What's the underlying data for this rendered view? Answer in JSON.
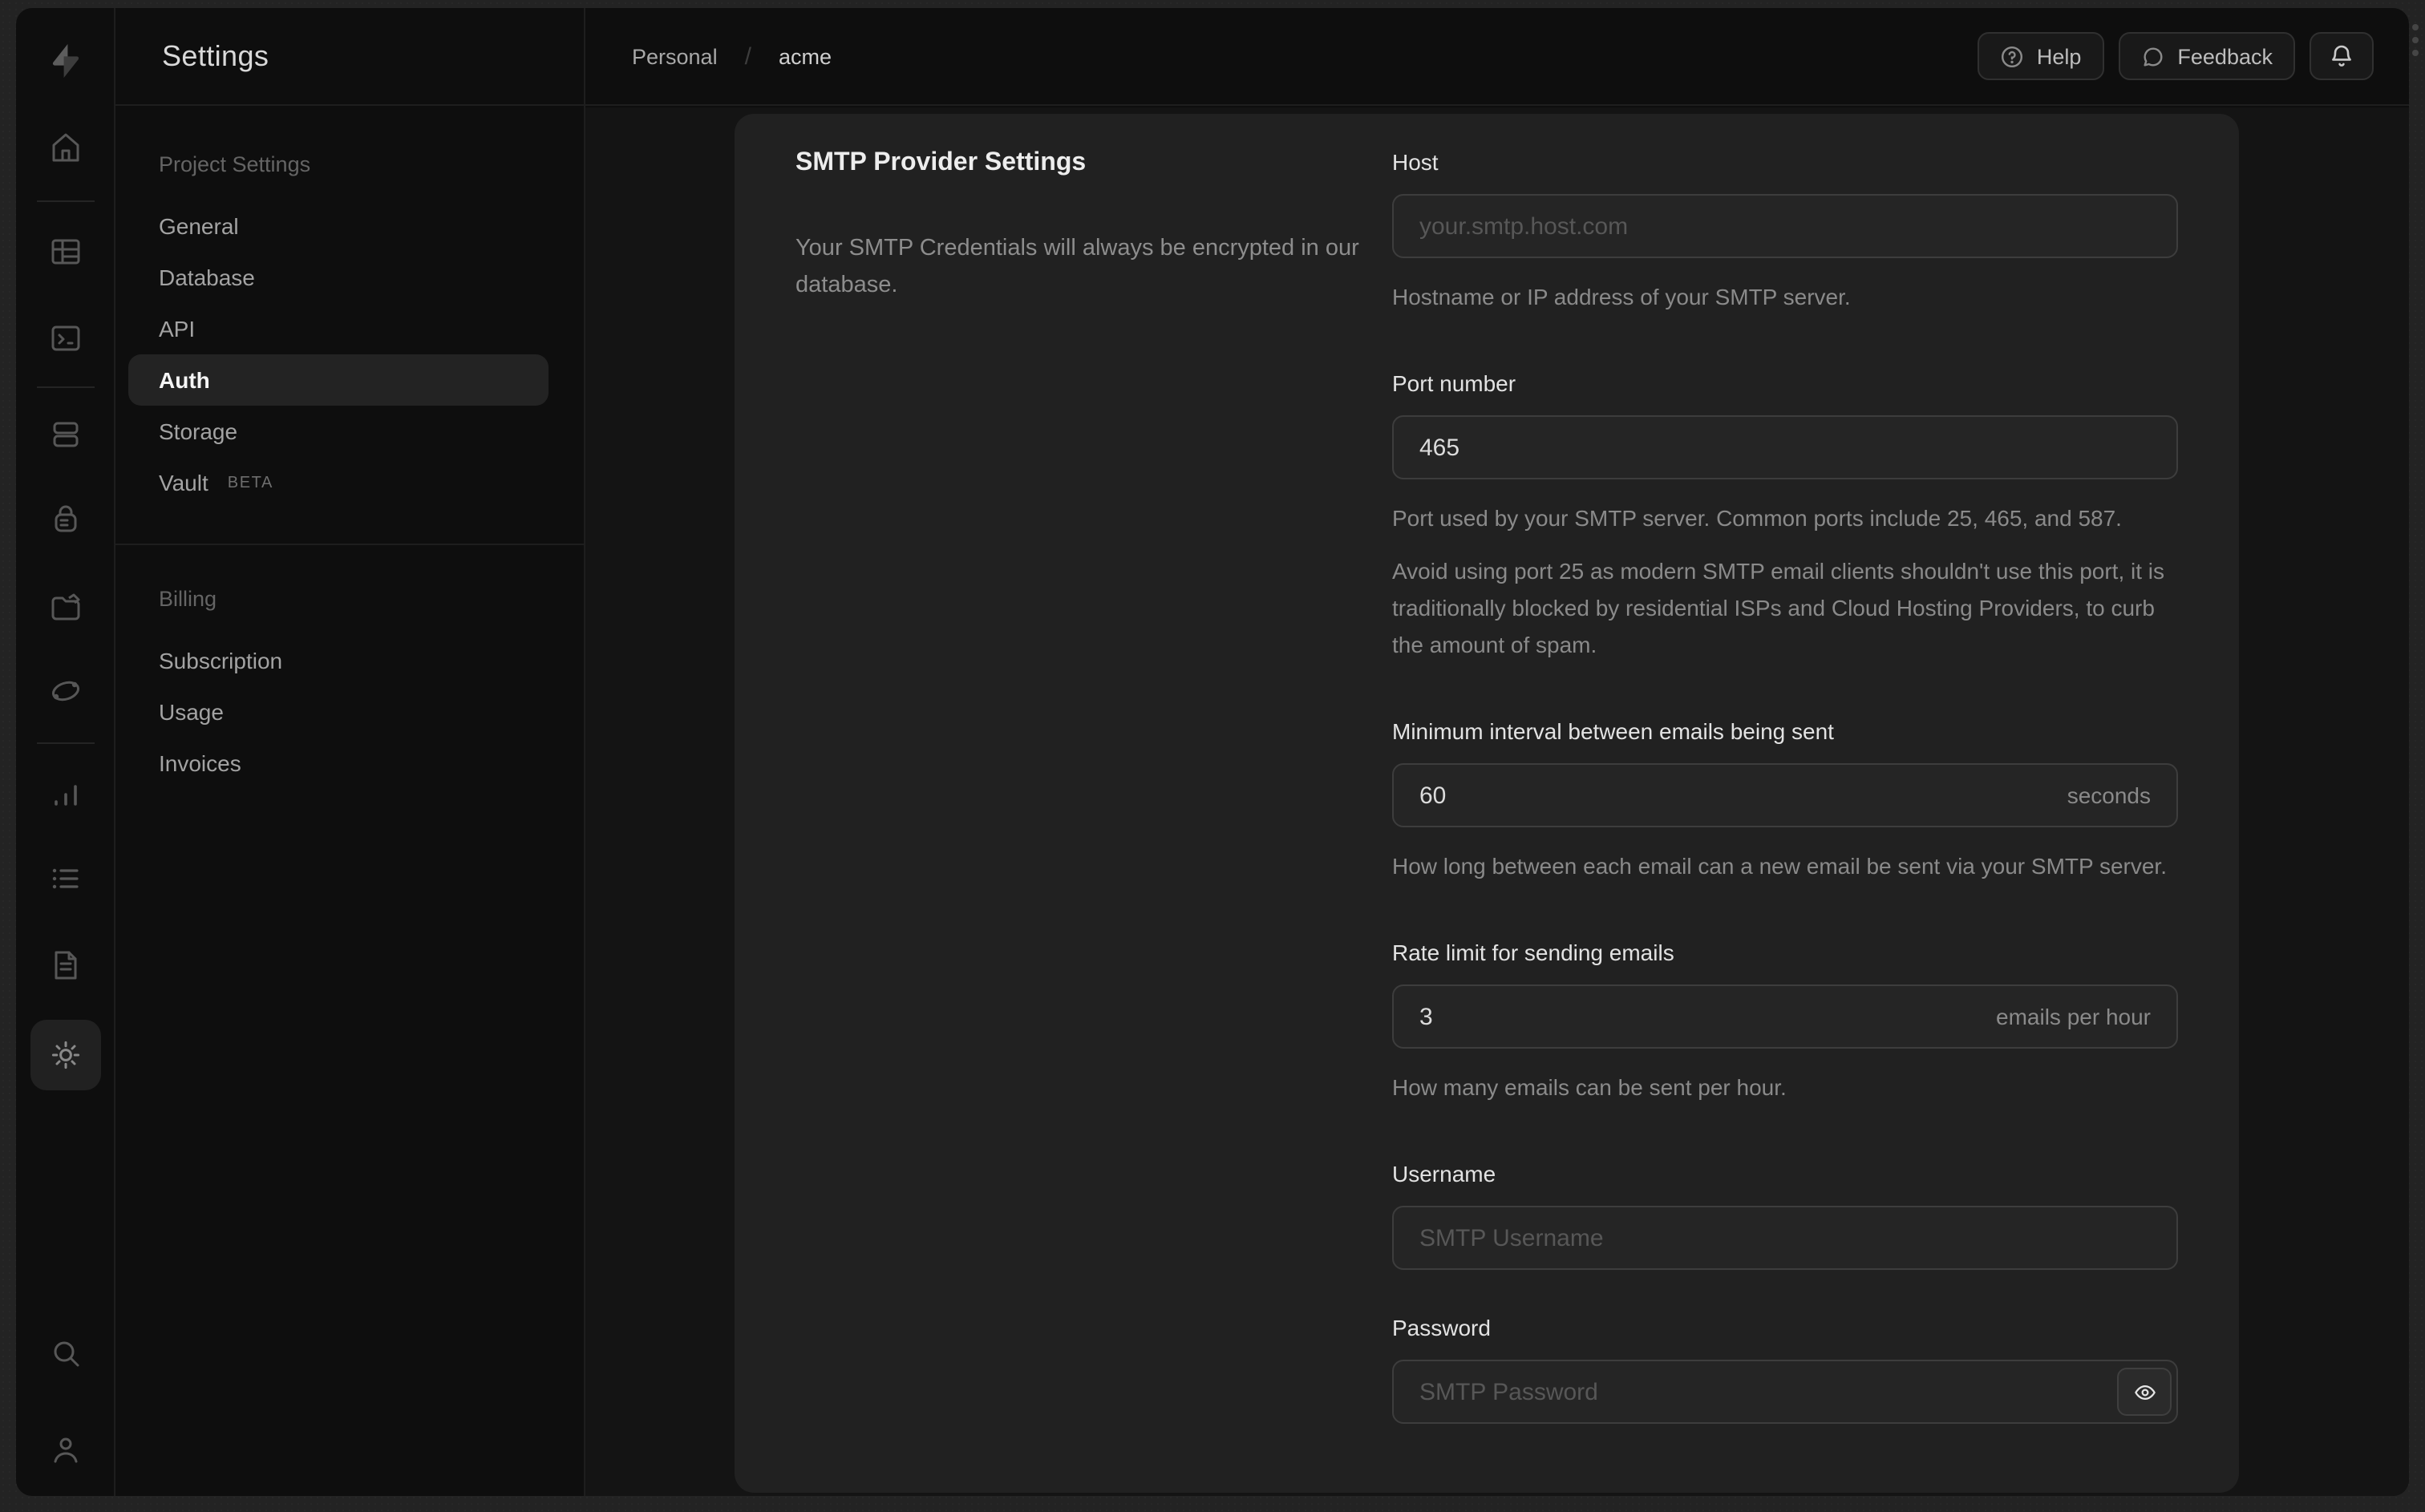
{
  "sidebar": {
    "title": "Settings",
    "sections": [
      {
        "label": "Project Settings",
        "items": [
          {
            "label": "General"
          },
          {
            "label": "Database"
          },
          {
            "label": "API"
          },
          {
            "label": "Auth",
            "active": true
          },
          {
            "label": "Storage"
          },
          {
            "label": "Vault",
            "badge": "BETA"
          }
        ]
      },
      {
        "label": "Billing",
        "items": [
          {
            "label": "Subscription"
          },
          {
            "label": "Usage"
          },
          {
            "label": "Invoices"
          }
        ]
      }
    ]
  },
  "rail": {
    "icons": [
      "supabase-logo",
      "home",
      "table-editor",
      "sql-editor",
      "database",
      "auth",
      "storage",
      "edge-functions",
      "reports",
      "logs",
      "docs",
      "settings",
      "search",
      "user"
    ]
  },
  "header": {
    "breadcrumb": {
      "org": "Personal",
      "separator": "/",
      "project": "acme"
    },
    "help_label": "Help",
    "feedback_label": "Feedback"
  },
  "panel": {
    "heading": "SMTP Provider Settings",
    "description": "Your SMTP Credentials will always be encrypted in our database.",
    "fields": {
      "host": {
        "label": "Host",
        "placeholder": "your.smtp.host.com",
        "helper": "Hostname or IP address of your SMTP server."
      },
      "port": {
        "label": "Port number",
        "value": "465",
        "helper": "Port used by your SMTP server. Common ports include 25, 465, and 587.",
        "note": "Avoid using port 25 as modern SMTP email clients shouldn't use this port, it is traditionally blocked by residential ISPs and Cloud Hosting Providers, to curb the amount of spam."
      },
      "interval": {
        "label": "Minimum interval between emails being sent",
        "value": "60",
        "suffix": "seconds",
        "helper": "How long between each email can a new email be sent via your SMTP server."
      },
      "rate": {
        "label": "Rate limit for sending emails",
        "value": "3",
        "suffix": "emails per hour",
        "helper": "How many emails can be sent per hour."
      },
      "username": {
        "label": "Username",
        "placeholder": "SMTP Username"
      },
      "password": {
        "label": "Password",
        "placeholder": "SMTP Password"
      }
    }
  }
}
